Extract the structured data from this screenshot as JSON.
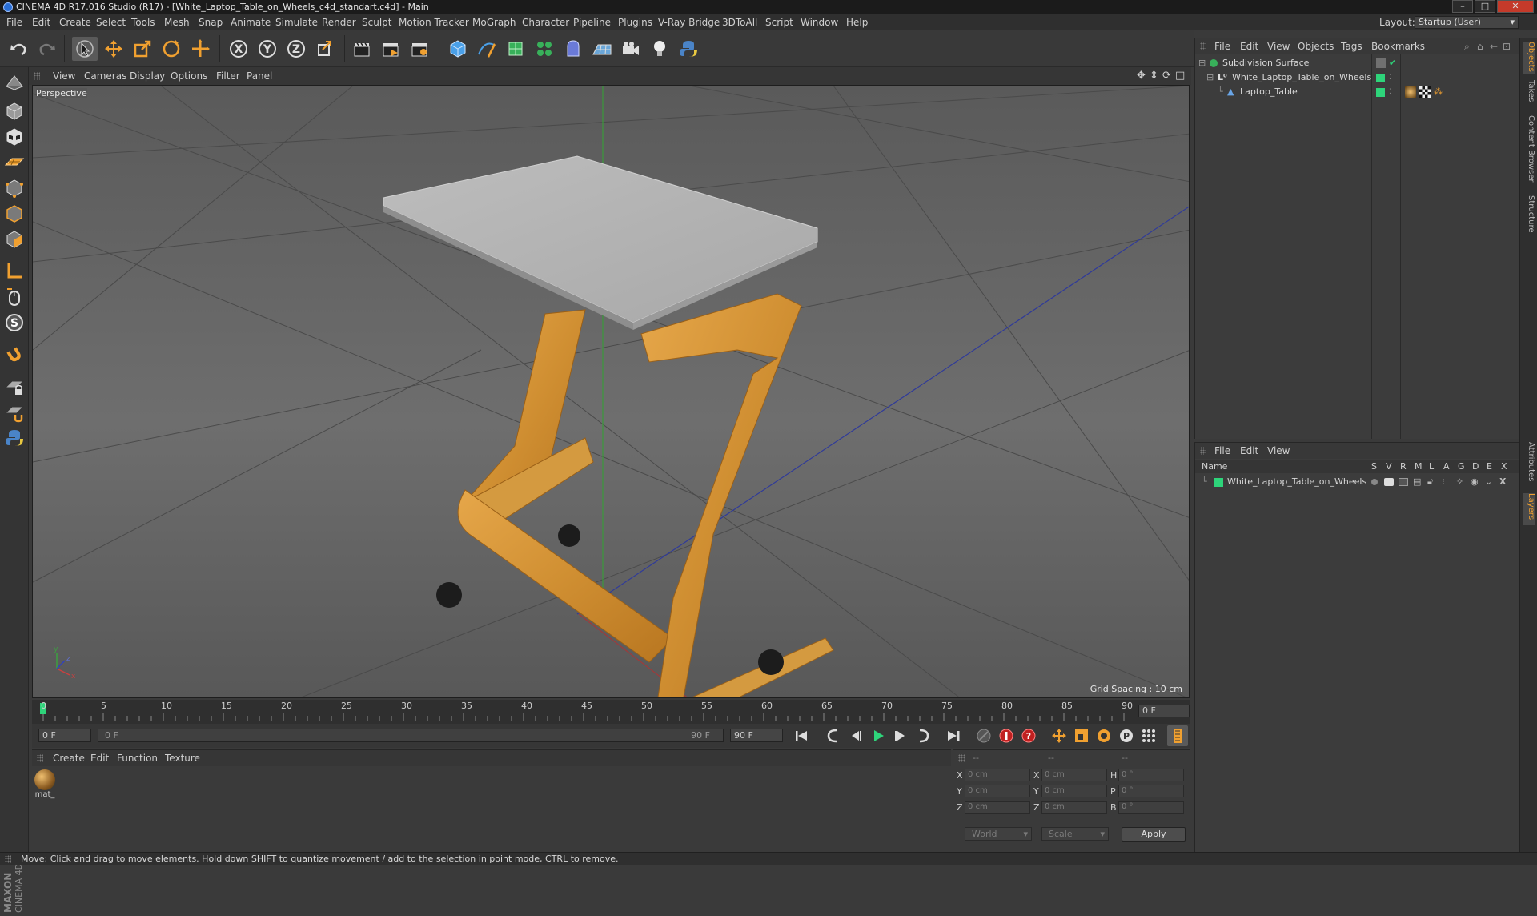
{
  "window": {
    "title": "CINEMA 4D R17.016 Studio (R17) - [White_Laptop_Table_on_Wheels_c4d_standart.c4d] - Main"
  },
  "menu": [
    "File",
    "Edit",
    "Create",
    "Select",
    "Tools",
    "Mesh",
    "Snap",
    "Animate",
    "Simulate",
    "Render",
    "Sculpt",
    "Motion Tracker",
    "MoGraph",
    "Character",
    "Pipeline",
    "Plugins",
    "V-Ray Bridge",
    "3DToAll",
    "Script",
    "Window",
    "Help"
  ],
  "layout": {
    "label": "Layout:",
    "value": "Startup (User)"
  },
  "viewport": {
    "menu": [
      "View",
      "Cameras",
      "Display",
      "Options",
      "Filter",
      "Panel"
    ],
    "label": "Perspective",
    "grid_spacing": "Grid Spacing : 10 cm"
  },
  "timeline": {
    "ticks": [
      "0",
      "5",
      "10",
      "15",
      "20",
      "25",
      "30",
      "35",
      "40",
      "45",
      "50",
      "55",
      "60",
      "65",
      "70",
      "75",
      "80",
      "85",
      "90"
    ],
    "frame_field": "0 F",
    "start": "0 F",
    "range_start": "0 F",
    "range_end": "90 F",
    "end": "90 F"
  },
  "material_panel": {
    "menu": [
      "Create",
      "Edit",
      "Function",
      "Texture"
    ],
    "materials": [
      {
        "name": "mat_"
      }
    ]
  },
  "coordinates": {
    "headers": [
      "--",
      "--",
      "--"
    ],
    "rows": [
      {
        "axis1": "X",
        "v1": "0 cm",
        "axis2": "X",
        "v2": "0 cm",
        "axis3": "H",
        "v3": "0 °"
      },
      {
        "axis1": "Y",
        "v1": "0 cm",
        "axis2": "Y",
        "v2": "0 cm",
        "axis3": "P",
        "v3": "0 °"
      },
      {
        "axis1": "Z",
        "v1": "0 cm",
        "axis2": "Z",
        "v2": "0 cm",
        "axis3": "B",
        "v3": "0 °"
      }
    ],
    "space": "World",
    "mode": "Scale",
    "apply": "Apply"
  },
  "objects_panel": {
    "menu": [
      "File",
      "Edit",
      "View",
      "Objects",
      "Tags",
      "Bookmarks"
    ],
    "items": [
      {
        "name": "Subdivision Surface"
      },
      {
        "name": "White_Laptop_Table_on_Wheels"
      },
      {
        "name": "Laptop_Table"
      }
    ]
  },
  "layers_panel": {
    "menu": [
      "File",
      "Edit",
      "View"
    ],
    "columns": [
      "Name",
      "S",
      "V",
      "R",
      "M",
      "L",
      "A",
      "G",
      "D",
      "E",
      "X"
    ],
    "items": [
      {
        "name": "White_Laptop_Table_on_Wheels"
      }
    ]
  },
  "side_tabs": [
    "Objects",
    "Takes",
    "Content Browser",
    "Structure",
    "Attributes",
    "Layers"
  ],
  "brand": {
    "maxon": "MAXON",
    "product": "CINEMA 4D"
  },
  "status": "Move: Click and drag to move elements. Hold down SHIFT to quantize movement / add to the selection in point mode, CTRL to remove.",
  "colors": {
    "accent": "#f0a030",
    "layer_green": "#2ed47a",
    "axis_x": "#c84040",
    "axis_y": "#3ca040",
    "axis_z": "#3040c0"
  }
}
